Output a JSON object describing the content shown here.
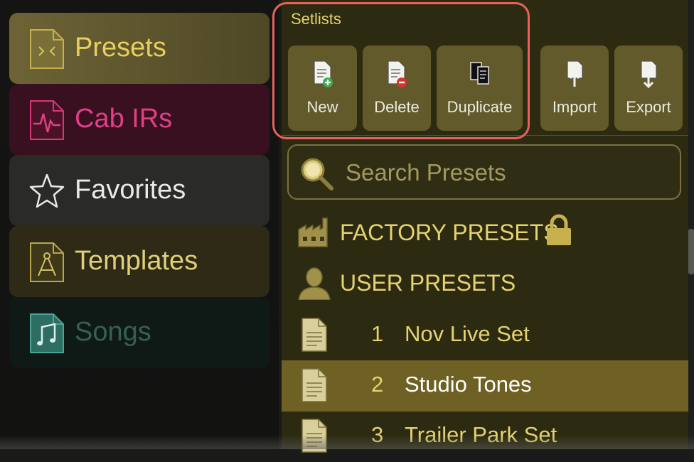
{
  "sidebar": {
    "items": [
      {
        "label": "Presets",
        "icon": "presets-icon"
      },
      {
        "label": "Cab IRs",
        "icon": "cab-ir-icon"
      },
      {
        "label": "Favorites",
        "icon": "star-icon"
      },
      {
        "label": "Templates",
        "icon": "templates-icon"
      },
      {
        "label": "Songs",
        "icon": "music-note-icon"
      }
    ]
  },
  "toolbar": {
    "section_title": "Setlists",
    "buttons": [
      {
        "label": "New",
        "icon": "new-document-icon"
      },
      {
        "label": "Delete",
        "icon": "delete-document-icon"
      },
      {
        "label": "Duplicate",
        "icon": "duplicate-icon"
      },
      {
        "label": "Import",
        "icon": "import-icon"
      },
      {
        "label": "Export",
        "icon": "export-icon"
      }
    ]
  },
  "search": {
    "placeholder": "Search Presets"
  },
  "groups": [
    {
      "label": "FACTORY PRESETS",
      "icon": "factory-icon",
      "locked": true
    },
    {
      "label": "USER PRESETS",
      "icon": "user-icon"
    }
  ],
  "setlists": [
    {
      "number": "1",
      "name": "Nov Live Set",
      "selected": false
    },
    {
      "number": "2",
      "name": "Studio Tones",
      "selected": true
    },
    {
      "number": "3",
      "name": "Trailer Park Set",
      "selected": false
    }
  ],
  "colors": {
    "accent_gold": "#e6d270",
    "selected_row": "#6e6123",
    "panel_bg": "#2c2b11",
    "highlight_outline": "#e8615d"
  }
}
